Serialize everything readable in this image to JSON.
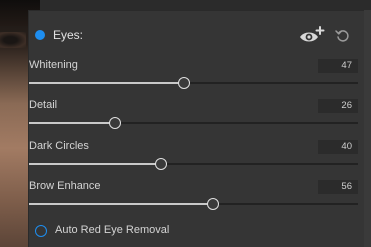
{
  "panel": {
    "title": "Eyes:",
    "icons": {
      "add_mask": "eye-plus-icon",
      "reset": "reset-icon"
    },
    "accent": "#1e8ef0"
  },
  "sliders": [
    {
      "label": "Whitening",
      "value": "47",
      "level": 47
    },
    {
      "label": "Detail",
      "value": "26",
      "level": 26
    },
    {
      "label": "Dark Circles",
      "value": "40",
      "level": 40
    },
    {
      "label": "Brow Enhance",
      "value": "56",
      "level": 56
    }
  ],
  "red_eye": {
    "label": "Auto Red Eye Removal",
    "checked": false
  }
}
